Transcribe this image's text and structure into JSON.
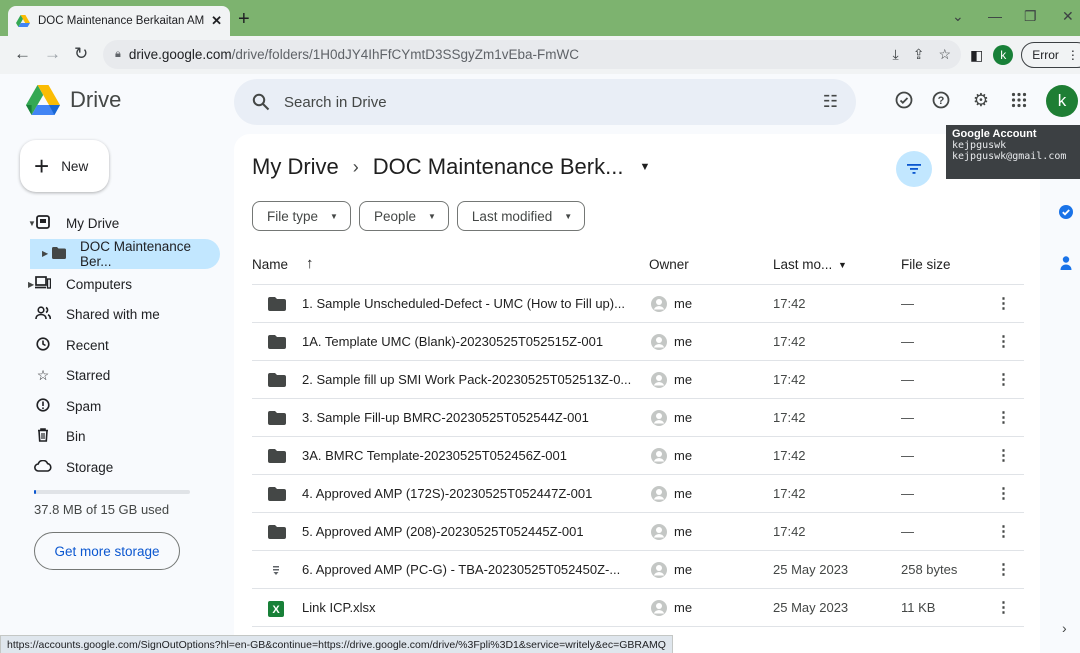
{
  "browser": {
    "tab_title": "DOC Maintenance Berkaitan AMP",
    "url_host": "drive.google.com",
    "url_path": "/drive/folders/1H0dJY4IhFfCYmtD3SSgyZm1vEba-FmWC",
    "profile_initial": "k",
    "error_label": "Error"
  },
  "header": {
    "app_name": "Drive",
    "search_placeholder": "Search in Drive",
    "avatar_initial": "k"
  },
  "tooltip": {
    "title": "Google Account",
    "name": "kejpguswk",
    "email": "kejpguswk@gmail.com"
  },
  "sidebar": {
    "new_label": "New",
    "items": [
      {
        "label": "My Drive",
        "icon": "my-drive-icon"
      },
      {
        "label": "DOC Maintenance Ber...",
        "icon": "folder-icon"
      },
      {
        "label": "Computers",
        "icon": "computer-icon"
      },
      {
        "label": "Shared with me",
        "icon": "people-icon"
      },
      {
        "label": "Recent",
        "icon": "clock-icon"
      },
      {
        "label": "Starred",
        "icon": "star-icon"
      },
      {
        "label": "Spam",
        "icon": "spam-icon"
      },
      {
        "label": "Bin",
        "icon": "bin-icon"
      },
      {
        "label": "Storage",
        "icon": "cloud-icon"
      }
    ],
    "storage_text": "37.8 MB of 15 GB used",
    "storage_used_fraction": 0.0025,
    "get_more_label": "Get more storage"
  },
  "main": {
    "breadcrumb_root": "My Drive",
    "breadcrumb_current": "DOC Maintenance Berk...",
    "filters": [
      "File type",
      "People",
      "Last modified"
    ],
    "columns": {
      "name": "Name",
      "owner": "Owner",
      "modified": "Last mo...",
      "size": "File size"
    },
    "rows": [
      {
        "name": "1. Sample Unscheduled-Defect -  UMC (How to Fill up)...",
        "type": "folder",
        "owner": "me",
        "modified": "17:42",
        "size": "—"
      },
      {
        "name": "1A. Template UMC (Blank)-20230525T052515Z-001",
        "type": "folder",
        "owner": "me",
        "modified": "17:42",
        "size": "—"
      },
      {
        "name": "2. Sample fill up SMI Work Pack-20230525T052513Z-0...",
        "type": "folder",
        "owner": "me",
        "modified": "17:42",
        "size": "—"
      },
      {
        "name": "3. Sample Fill-up BMRC-20230525T052544Z-001",
        "type": "folder",
        "owner": "me",
        "modified": "17:42",
        "size": "—"
      },
      {
        "name": "3A. BMRC Template-20230525T052456Z-001",
        "type": "folder",
        "owner": "me",
        "modified": "17:42",
        "size": "—"
      },
      {
        "name": "4. Approved AMP (172S)-20230525T052447Z-001",
        "type": "folder",
        "owner": "me",
        "modified": "17:42",
        "size": "—"
      },
      {
        "name": "5. Approved AMP (208)-20230525T052445Z-001",
        "type": "folder",
        "owner": "me",
        "modified": "17:42",
        "size": "—"
      },
      {
        "name": "6. Approved AMP (PC-G) - TBA-20230525T052450Z-...",
        "type": "file",
        "owner": "me",
        "modified": "25 May 2023",
        "size": "258 bytes"
      },
      {
        "name": "Link ICP.xlsx",
        "type": "sheet",
        "owner": "me",
        "modified": "25 May 2023",
        "size": "11 KB"
      }
    ]
  },
  "status_url": "https://accounts.google.com/SignOutOptions?hl=en-GB&continue=https://drive.google.com/drive/%3Fpli%3D1&service=writely&ec=GBRAMQ",
  "colors": {
    "accent": "#0b57d0",
    "selected": "#c2e7ff",
    "tabbar": "#7db36f",
    "avatar": "#1e7e34"
  }
}
